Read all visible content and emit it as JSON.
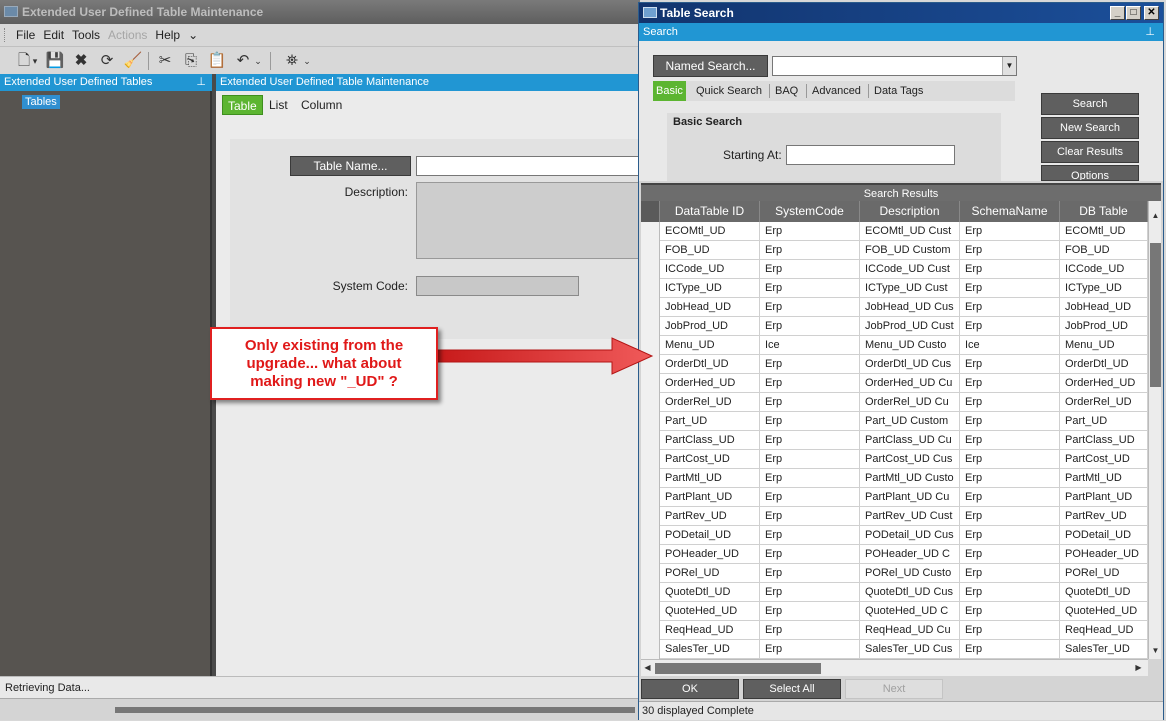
{
  "main_window": {
    "title": "Extended User Defined Table Maintenance",
    "menu": [
      "File",
      "Edit",
      "Tools",
      "Actions",
      "Help"
    ],
    "tree_panel_title": "Extended User Defined Tables",
    "tree_node": "Tables",
    "content_title": "Extended User Defined Table Maintenance",
    "tabs": [
      "Table",
      "List",
      "Column"
    ],
    "table_name_button": "Table Name...",
    "description_label": "Description:",
    "system_code_label": "System Code:",
    "status": "Retrieving Data..."
  },
  "search_window": {
    "title": "Table Search",
    "section_label": "Search",
    "named_search_button": "Named Search...",
    "tabs": [
      "Basic",
      "Quick Search",
      "BAQ",
      "Advanced",
      "Data Tags"
    ],
    "basic_search_label": "Basic Search",
    "starting_at_label": "Starting At:",
    "buttons": {
      "search": "Search",
      "new_search": "New Search",
      "clear_results": "Clear Results",
      "options": "Options"
    },
    "results_label": "Search Results",
    "columns": [
      "DataTable ID",
      "SystemCode",
      "Description",
      "SchemaName",
      "DB Table"
    ],
    "rows": [
      [
        "ECOMtl_UD",
        "Erp",
        "ECOMtl_UD Cust",
        "Erp",
        "ECOMtl_UD"
      ],
      [
        "FOB_UD",
        "Erp",
        "FOB_UD Custom",
        "Erp",
        "FOB_UD"
      ],
      [
        "ICCode_UD",
        "Erp",
        "ICCode_UD Cust",
        "Erp",
        "ICCode_UD"
      ],
      [
        "ICType_UD",
        "Erp",
        "ICType_UD Cust",
        "Erp",
        "ICType_UD"
      ],
      [
        "JobHead_UD",
        "Erp",
        "JobHead_UD Cus",
        "Erp",
        "JobHead_UD"
      ],
      [
        "JobProd_UD",
        "Erp",
        "JobProd_UD Cust",
        "Erp",
        "JobProd_UD"
      ],
      [
        "Menu_UD",
        "Ice",
        "Menu_UD Custo",
        "Ice",
        "Menu_UD"
      ],
      [
        "OrderDtl_UD",
        "Erp",
        "OrderDtl_UD Cus",
        "Erp",
        "OrderDtl_UD"
      ],
      [
        "OrderHed_UD",
        "Erp",
        "OrderHed_UD Cu",
        "Erp",
        "OrderHed_UD"
      ],
      [
        "OrderRel_UD",
        "Erp",
        "OrderRel_UD Cu",
        "Erp",
        "OrderRel_UD"
      ],
      [
        "Part_UD",
        "Erp",
        "Part_UD Custom",
        "Erp",
        "Part_UD"
      ],
      [
        "PartClass_UD",
        "Erp",
        "PartClass_UD Cu",
        "Erp",
        "PartClass_UD"
      ],
      [
        "PartCost_UD",
        "Erp",
        "PartCost_UD Cus",
        "Erp",
        "PartCost_UD"
      ],
      [
        "PartMtl_UD",
        "Erp",
        "PartMtl_UD Custo",
        "Erp",
        "PartMtl_UD"
      ],
      [
        "PartPlant_UD",
        "Erp",
        "PartPlant_UD Cu",
        "Erp",
        "PartPlant_UD"
      ],
      [
        "PartRev_UD",
        "Erp",
        "PartRev_UD Cust",
        "Erp",
        "PartRev_UD"
      ],
      [
        "PODetail_UD",
        "Erp",
        "PODetail_UD Cus",
        "Erp",
        "PODetail_UD"
      ],
      [
        "POHeader_UD",
        "Erp",
        "POHeader_UD C",
        "Erp",
        "POHeader_UD"
      ],
      [
        "PORel_UD",
        "Erp",
        "PORel_UD Custo",
        "Erp",
        "PORel_UD"
      ],
      [
        "QuoteDtl_UD",
        "Erp",
        "QuoteDtl_UD Cus",
        "Erp",
        "QuoteDtl_UD"
      ],
      [
        "QuoteHed_UD",
        "Erp",
        "QuoteHed_UD C",
        "Erp",
        "QuoteHed_UD"
      ],
      [
        "ReqHead_UD",
        "Erp",
        "ReqHead_UD Cu",
        "Erp",
        "ReqHead_UD"
      ],
      [
        "SalesTer_UD",
        "Erp",
        "SalesTer_UD Cus",
        "Erp",
        "SalesTer_UD"
      ]
    ],
    "bottom_buttons": {
      "ok": "OK",
      "select_all": "Select All",
      "next": "Next"
    },
    "status": "30 displayed Complete"
  },
  "annotation": {
    "lines": [
      "Only existing from the",
      "upgrade... what about",
      "making new \"_UD\" ?"
    ],
    "color": "#e01818"
  },
  "colors": {
    "accent_blue": "#2196d3",
    "active_tab": "#5cb531",
    "dark_button": "#5f5f5f"
  }
}
